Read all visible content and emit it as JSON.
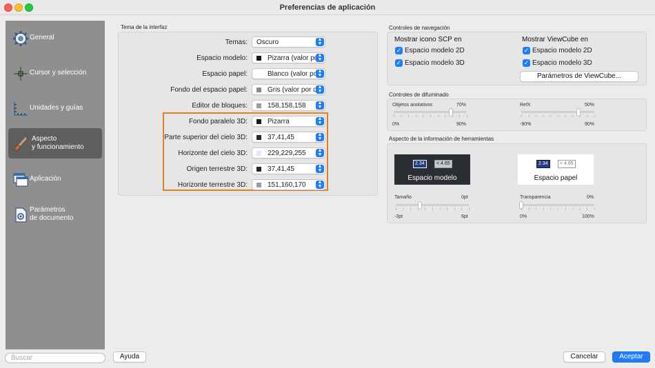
{
  "window": {
    "title": "Preferencias de aplicación"
  },
  "sidebar": {
    "items": [
      {
        "label": "General",
        "icon": "gear-icon",
        "selected": false
      },
      {
        "label": "Cursor y selección",
        "icon": "crosshair-icon",
        "selected": false
      },
      {
        "label": "Unidades y guías",
        "icon": "ruler-axes-icon",
        "selected": false
      },
      {
        "label": "Aspecto\ny funcionamiento",
        "icon": "paintbrush-icon",
        "selected": true
      },
      {
        "label": "Aplicación",
        "icon": "app-windows-icon",
        "selected": false
      },
      {
        "label": "Parámetros\nde documento",
        "icon": "document-gear-icon",
        "selected": false
      }
    ],
    "search_placeholder": "Buscar"
  },
  "theme": {
    "title": "Tema de la interfaz",
    "rows": [
      {
        "label": "Temas:",
        "value": "Oscuro",
        "swatch": ""
      },
      {
        "label": "Espacio modelo:",
        "value": "Pizarra (valor por defecto)",
        "swatch": "#1a1a1a"
      },
      {
        "label": "Espacio papel:",
        "value": "Blanco (valor por defecto)",
        "swatch": ""
      },
      {
        "label": "Fondo del espacio papel:",
        "value": "Gris (valor por defecto)",
        "swatch": "#8a8a8a"
      },
      {
        "label": "Editor de bloques:",
        "value": "158,158,158",
        "swatch": "#9e9e9e"
      },
      {
        "label": "Fondo paralelo 3D:",
        "value": "Pizarra",
        "swatch": "#1a1a1a"
      },
      {
        "label": "Parte superior del cielo 3D:",
        "value": "37,41,45",
        "swatch": "#25292d"
      },
      {
        "label": "Horizonte del cielo 3D:",
        "value": "229,229,255",
        "swatch": "#e5e5ff"
      },
      {
        "label": "Origen terrestre 3D:",
        "value": "37,41,45",
        "swatch": "#25292d"
      },
      {
        "label": "Horizonte terrestre 3D:",
        "value": "151,160,170",
        "swatch": "#97a0aa"
      }
    ]
  },
  "nav": {
    "title": "Controles de navegación",
    "scp": {
      "title": "Mostrar icono SCP en",
      "model2d": "Espacio modelo 2D",
      "model3d": "Espacio modelo 3D"
    },
    "viewcube": {
      "title": "Mostrar ViewCube en",
      "model2d": "Espacio modelo 2D",
      "model3d": "Espacio modelo 3D",
      "button": "Parámetros de ViewCube..."
    }
  },
  "fade": {
    "title": "Controles de difuminado",
    "annot": {
      "label": "Objetos anotativos",
      "value": "70%",
      "min": "0%",
      "max": "90%",
      "fraction": 0.78
    },
    "refx": {
      "label": "RefX",
      "value": "50%",
      "min": "-90%",
      "max": "90%",
      "fraction": 0.78
    }
  },
  "tooltip": {
    "title": "Aspecto de la información de herramientas",
    "model_label": "Espacio modelo",
    "paper_label": "Espacio papel",
    "val1": "2.34",
    "val2": "< 4.65",
    "size": {
      "label": "Tamaño",
      "value": "0pt",
      "min": "-3pt",
      "max": "6pt",
      "fraction": 0.33
    },
    "transp": {
      "label": "Transparencia",
      "value": "0%",
      "min": "0%",
      "max": "100%",
      "fraction": 0.0
    }
  },
  "footer": {
    "help": "Ayuda",
    "cancel": "Cancelar",
    "accept": "Aceptar"
  },
  "colors": {
    "accent": "#1f7dfa",
    "highlight": "#e67e22",
    "sidebar": "#8f8f8f",
    "sidebar_selected": "#5e5e5e"
  }
}
